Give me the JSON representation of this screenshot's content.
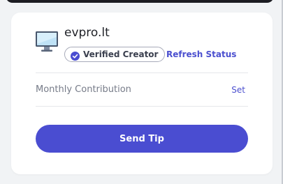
{
  "publisher": {
    "name": "evpro.lt",
    "icon": "monitor-icon",
    "verified_label": "Verified Creator",
    "verified_icon": "check-circle-icon",
    "refresh_label": "Refresh Status"
  },
  "contribution": {
    "label": "Monthly Contribution",
    "set_label": "Set"
  },
  "actions": {
    "send_tip_label": "Send Tip"
  },
  "colors": {
    "accent": "#4a4dd1",
    "link": "#4b4fcf",
    "card_background": "#ffffff",
    "page_background": "#f1f3f5"
  }
}
